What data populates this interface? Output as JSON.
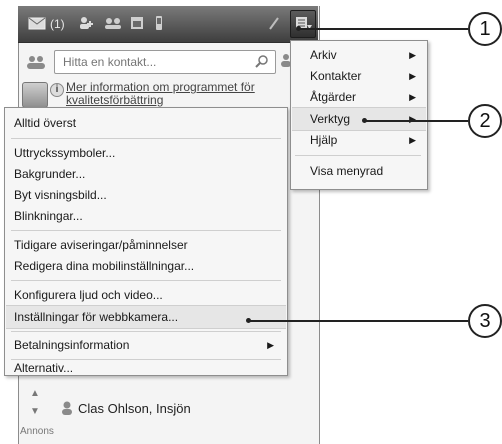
{
  "toolbar": {
    "mail_count": "(1)"
  },
  "search": {
    "placeholder": "Hitta en kontakt..."
  },
  "info": {
    "line1": "Mer information om programmet för",
    "line2": "kvalitetsförbättring"
  },
  "main_menu": {
    "items": [
      "Alltid överst",
      "Uttryckssymboler...",
      "Bakgrunder...",
      "Byt visningsbild...",
      "Blinkningar...",
      "Tidigare aviseringar/påminnelser",
      "Redigera dina mobilinställningar...",
      "Konfigurera ljud och video...",
      "Inställningar för webbkamera...",
      "Betalningsinformation",
      "Alternativ..."
    ]
  },
  "submenu": {
    "items": [
      "Arkiv",
      "Kontakter",
      "Åtgärder",
      "Verktyg",
      "Hjälp",
      "Visa menyrad"
    ]
  },
  "contact": {
    "name": "Clas Ohlson, Insjön"
  },
  "ads_label": "Annons",
  "callouts": [
    "1",
    "2",
    "3"
  ],
  "colors": {
    "toolbar_top": "#7a7a7a",
    "toolbar_bottom": "#3e3e3e",
    "menu_bg": "#f6f6f6",
    "highlight": "#e6e6e6"
  }
}
